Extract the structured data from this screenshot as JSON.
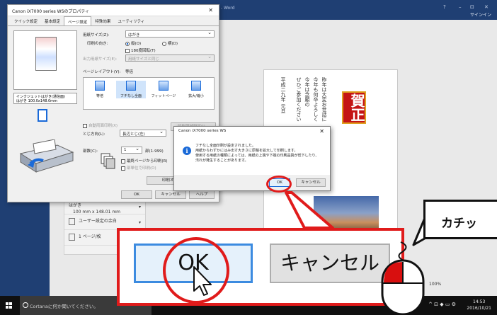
{
  "word": {
    "title": "年賀状文面 - Word",
    "signin": "サインイン",
    "window_controls": [
      "?",
      "–",
      "⊡",
      "✕"
    ],
    "zoom_label": "100%"
  },
  "document": {
    "greeting_columns": [
      "昨年は大変お世話に",
      "今年も何卒よろしく",
      "今年は念願の",
      "ぜひご参加ください",
      "平成二九年 元旦"
    ],
    "stamp_text": "賀正"
  },
  "doc_side": {
    "paper_label": "はがき",
    "paper_size": "100 mm x 148.01 mm",
    "margin_label": "ユーザー設定の余白",
    "pages_label": "1 ページ/枚"
  },
  "print_dialog": {
    "title": "Canon iX7000 series WSのプロパティ",
    "tabs": [
      "クイック設定",
      "基本設定",
      "ページ設定",
      "特殊効果",
      "ユーティリティ"
    ],
    "active_tab": 2,
    "media_text": "インクジェットはがき(通信面)\nはがき 100.0x148.0mm",
    "paper_size_label": "用紙サイズ(Z):",
    "paper_size_value": "はがき",
    "orientation_label": "印刷の向き:",
    "orientation_portrait": "縦(O)",
    "orientation_landscape": "横(D)",
    "rotate_label": "180度回転(T)",
    "output_size_label": "出力用紙サイズ(E):",
    "output_size_value": "用紙サイズと同じ",
    "layout_label": "ページレイアウト(Y):",
    "layout_value": "等倍",
    "layout_options": [
      "等倍",
      "フチなし全面",
      "フィットページ",
      "拡大/縮小"
    ],
    "auto_duplex_label": "自動両面印刷(X)",
    "binding_label": "とじ方向(L):",
    "binding_value": "長辺とじ(左)",
    "binding_margin_button": "印刷領域設定(J)...",
    "copies_label": "部数(C):",
    "copies_value": "1",
    "copies_range": "部(1-999)",
    "last_page_first_label": "最終ページから印刷(R)",
    "collate_label": "部単位で印刷(O)",
    "print_options_button": "印刷オプション(N)...",
    "ok_button": "OK",
    "cancel_button": "キャンセル",
    "help_button": "ヘルプ"
  },
  "message_box": {
    "title": "Canon iX7000 series WS",
    "line1": "フチなし全面印刷が設定されました。",
    "line2": "用紙からわずかにはみ出す大きさに原稿を拡大して印刷します。",
    "line3": "使用する用紙の種類によっては、用紙の上端や下端の印刷品質が低下したり、",
    "line4": "汚れが発生することがあります。",
    "ok": "OK",
    "cancel": "キャンセル"
  },
  "zoom_callout": {
    "ok": "OK",
    "cancel": "キャンセル",
    "bubble_text": "カチッ"
  },
  "taskbar": {
    "search_placeholder": "Cortanaに何か聞いてください。",
    "time": "14:53",
    "date": "2016/10/21"
  },
  "colors": {
    "highlight_red": "#e01b1b",
    "word_blue": "#1f3f73",
    "accent_blue": "#1a6ad8"
  }
}
